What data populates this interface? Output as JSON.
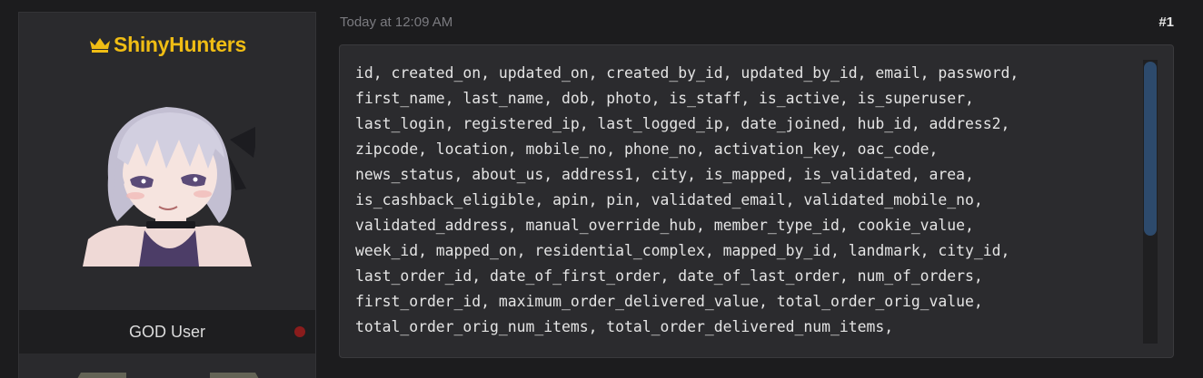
{
  "user": {
    "username": "ShinyHunters",
    "title": "GOD User",
    "crown_icon": "crown-icon",
    "status": "offline"
  },
  "post": {
    "timestamp": "Today at 12:09 AM",
    "number": "#1",
    "code_text": "id, created_on, updated_on, created_by_id, updated_by_id, email, password,\nfirst_name, last_name, dob, photo, is_staff, is_active, is_superuser,\nlast_login, registered_ip, last_logged_ip, date_joined, hub_id, address2,\nzipcode, location, mobile_no, phone_no, activation_key, oac_code,\nnews_status, about_us, address1, city, is_mapped, is_validated, area,\nis_cashback_eligible, apin, pin, validated_email, validated_mobile_no,\nvalidated_address, manual_override_hub, member_type_id, cookie_value,\nweek_id, mapped_on, residential_complex, mapped_by_id, landmark, city_id,\nlast_order_id, date_of_first_order, date_of_last_order, num_of_orders,\nfirst_order_id, maximum_order_delivered_value, total_order_orig_value,\ntotal_order_orig_num_items, total_order_delivered_num_items,"
  },
  "colors": {
    "background": "#1c1c1e",
    "panel": "#2a2a2d",
    "username": "#f0bd14",
    "code_bg": "#2b2b2e",
    "scroll_thumb": "#2d4a6c",
    "status_dot": "#8a1c1c"
  }
}
